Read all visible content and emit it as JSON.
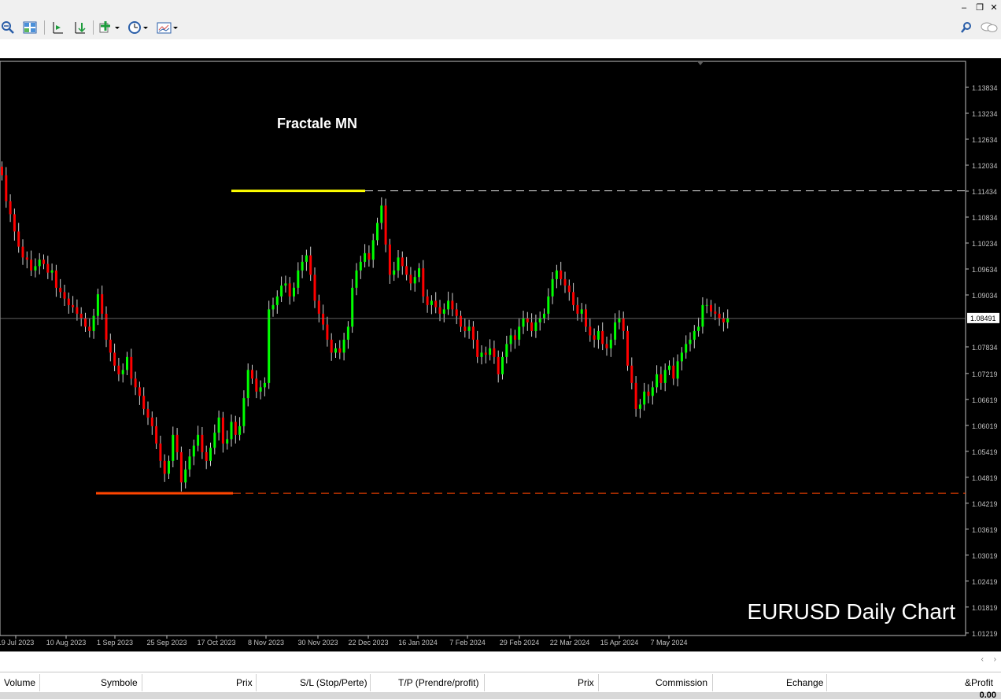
{
  "window": {
    "minimize_icon": "minimize-icon",
    "restore_icon": "restore-icon",
    "close_icon": "close-icon"
  },
  "toolbar": {
    "buttons": [
      "zoom-out-icon",
      "tile-windows-icon",
      "chart-shift-icon",
      "autoscroll-icon",
      "indicators-icon",
      "periods-icon",
      "templates-icon",
      "search-icon",
      "chat-icon"
    ]
  },
  "colors": {
    "bull": "#00ff00",
    "bear": "#ff0000",
    "wick": "#d0d0d0",
    "fractal_high": "#ffff00",
    "fractal_low": "#ff4500",
    "price_line": "#808080"
  },
  "chart_labels": {
    "fractal_title": "Fractale MN",
    "watermark": "EURUSD Daily Chart",
    "current_price": "1.08491"
  },
  "chart_data": {
    "type": "candlestick",
    "y_ticks": [
      "1.13834",
      "1.13234",
      "1.12634",
      "1.12034",
      "1.11434",
      "1.10834",
      "1.10234",
      "1.09634",
      "1.09034",
      "1.07834",
      "1.07219",
      "1.06619",
      "1.06019",
      "1.05419",
      "1.04819",
      "1.04219",
      "1.03619",
      "1.03019",
      "1.02419",
      "1.01819",
      "1.01219"
    ],
    "x_ticks": [
      "19 Jul 2023",
      "10 Aug 2023",
      "1 Sep 2023",
      "25 Sep 2023",
      "17 Oct 2023",
      "8 Nov 2023",
      "30 Nov 2023",
      "22 Dec 2023",
      "16 Jan 2024",
      "7 Feb 2024",
      "29 Feb 2024",
      "22 Mar 2024",
      "15 Apr 2024",
      "7 May 2024"
    ],
    "fractal_high": 1.1144,
    "fractal_low": 1.0445,
    "current_price": 1.08491,
    "closes": [
      1.118,
      1.112,
      1.109,
      1.105,
      1.1015,
      1.099,
      1.0985,
      1.096,
      1.097,
      1.0985,
      1.0975,
      1.0955,
      1.096,
      1.092,
      1.091,
      1.0895,
      1.088,
      1.0875,
      1.086,
      1.085,
      1.083,
      1.082,
      1.0855,
      1.0905,
      1.086,
      1.08,
      1.077,
      1.074,
      1.072,
      1.073,
      1.076,
      1.071,
      1.069,
      1.067,
      1.064,
      1.062,
      1.06,
      1.056,
      1.052,
      1.049,
      1.052,
      1.058,
      1.054,
      1.047,
      1.05,
      1.053,
      1.0555,
      1.058,
      1.054,
      1.052,
      1.055,
      1.0585,
      1.062,
      1.056,
      1.057,
      1.061,
      1.058,
      1.06,
      1.0665,
      1.073,
      1.071,
      1.068,
      1.069,
      1.07,
      1.087,
      1.088,
      1.09,
      1.0925,
      1.093,
      1.09,
      1.092,
      1.096,
      1.098,
      1.0995,
      1.095,
      1.089,
      1.086,
      1.0835,
      1.08,
      1.077,
      1.078,
      1.077,
      1.08,
      1.083,
      1.092,
      1.096,
      1.098,
      1.1,
      1.0985,
      1.103,
      1.107,
      1.111,
      1.102,
      1.095,
      1.096,
      1.099,
      1.097,
      1.095,
      1.093,
      1.0945,
      1.0965,
      1.09,
      1.088,
      1.089,
      1.0875,
      1.086,
      1.087,
      1.089,
      1.087,
      1.0855,
      1.083,
      1.082,
      1.083,
      1.08,
      1.076,
      1.077,
      1.0765,
      1.078,
      1.076,
      1.072,
      1.076,
      1.079,
      1.081,
      1.08,
      1.083,
      1.085,
      1.084,
      1.082,
      1.084,
      1.085,
      1.086,
      1.09,
      1.094,
      1.096,
      1.094,
      1.0925,
      1.091,
      1.088,
      1.086,
      1.087,
      1.083,
      1.081,
      1.08,
      1.082,
      1.079,
      1.078,
      1.08,
      1.084,
      1.085,
      1.082,
      1.074,
      1.07,
      1.064,
      1.065,
      1.068,
      1.067,
      1.069,
      1.072,
      1.07,
      1.073,
      1.074,
      1.071,
      1.075,
      1.077,
      1.079,
      1.08,
      1.082,
      1.083,
      1.088,
      1.088,
      1.0865,
      1.086,
      1.085,
      1.084,
      1.085
    ]
  },
  "terminal": {
    "columns": [
      "Volume",
      "Symbole",
      "Prix",
      "S/L (Stop/Perte)",
      "T/P (Prendre/profit)",
      "Prix",
      "Commission",
      "Echange",
      "&Profit"
    ],
    "footer_value": "0.00"
  }
}
